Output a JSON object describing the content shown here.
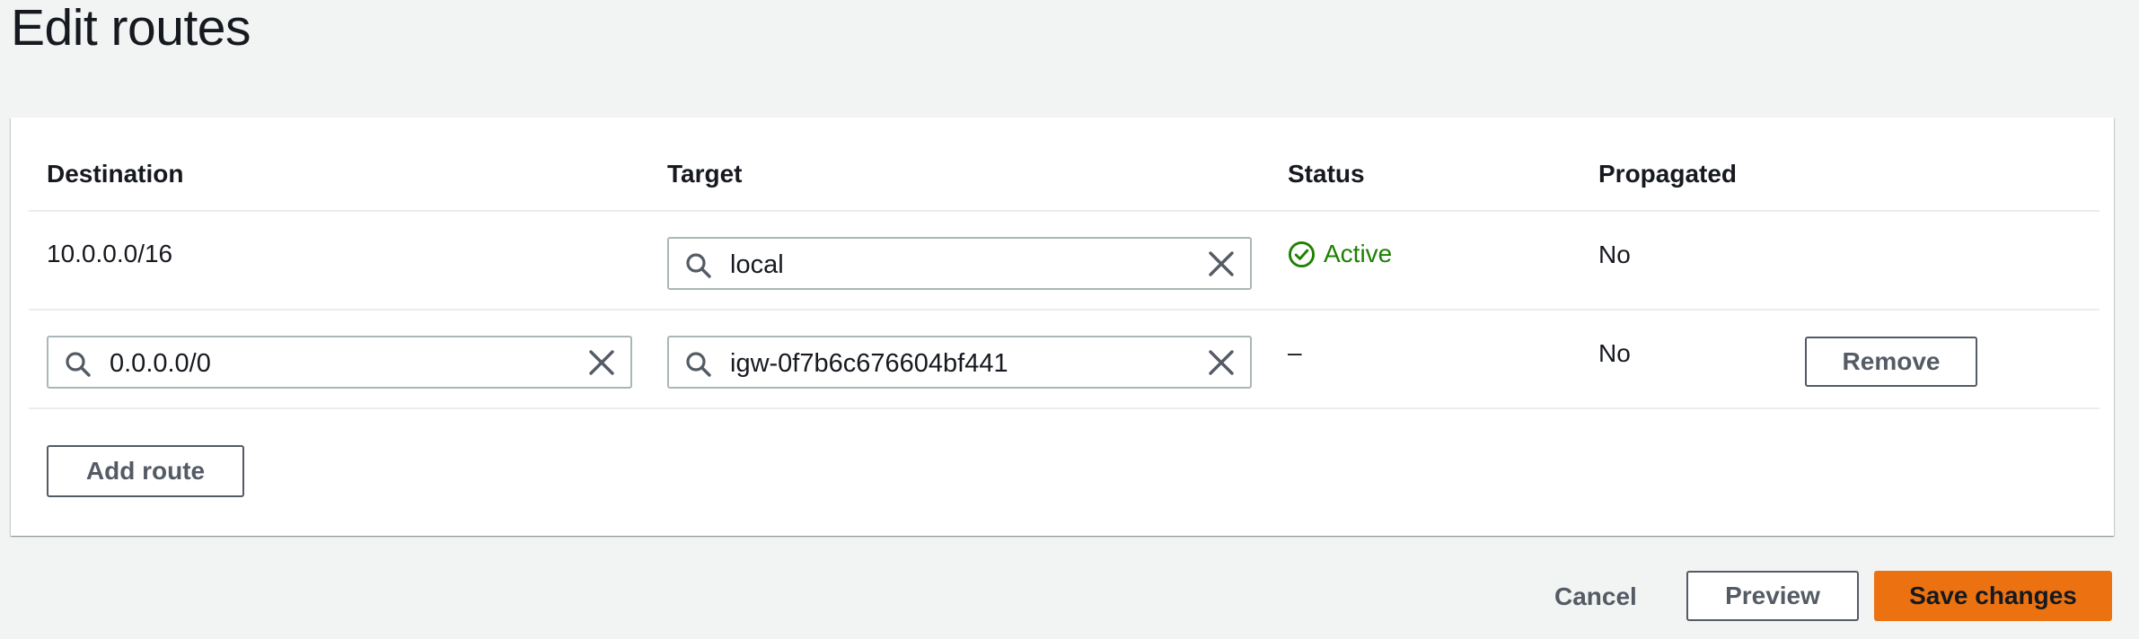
{
  "page": {
    "title": "Edit routes"
  },
  "table": {
    "headers": {
      "destination": "Destination",
      "target": "Target",
      "status": "Status",
      "propagated": "Propagated"
    },
    "rows": [
      {
        "destination": "10.0.0.0/16",
        "target": "local",
        "status": "Active",
        "propagated": "No"
      },
      {
        "destination": "0.0.0.0/0",
        "target": "igw-0f7b6c676604bf441",
        "status": "–",
        "propagated": "No",
        "remove_label": "Remove"
      }
    ],
    "add_route_label": "Add route"
  },
  "footer": {
    "cancel_label": "Cancel",
    "preview_label": "Preview",
    "save_label": "Save changes"
  },
  "colors": {
    "accent": "#ec7211",
    "status_active": "#1d8102",
    "background": "#f2f3f3"
  },
  "icons": {
    "search": "search-icon",
    "clear": "close-icon",
    "status": "check-circle-icon"
  }
}
